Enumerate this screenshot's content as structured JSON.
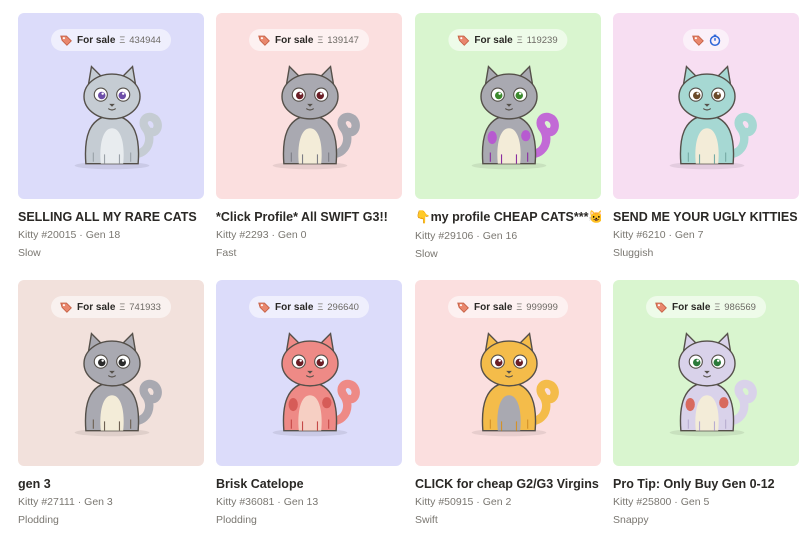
{
  "cards": [
    {
      "bg": "#dcdcfa",
      "status": "For sale",
      "eth": "Ξ",
      "price": "434944",
      "timer": false,
      "title": "SELLING ALL MY RARE CATS",
      "kitty": "Kitty #20015",
      "gen": "Gen 18",
      "speed": "Slow",
      "body": "#c5ccd3",
      "belly": "#e8ecef",
      "tail": "#c5ccd3",
      "eye": "#6d4ea8",
      "spots": "",
      "accent": "#9aa1a8"
    },
    {
      "bg": "#fbdfdf",
      "status": "For sale",
      "eth": "Ξ",
      "price": "139147",
      "timer": false,
      "title": "*Click Profile* All SWIFT G3!!",
      "kitty": "Kitty #2293",
      "gen": "Gen 0",
      "speed": "Fast",
      "body": "#a9a9b1",
      "belly": "#f3ecd8",
      "tail": "#a9a9b1",
      "eye": "#6b1f27",
      "spots": "",
      "accent": "#7d7d85"
    },
    {
      "bg": "#d9f5cf",
      "status": "For sale",
      "eth": "Ξ",
      "price": "119239",
      "timer": false,
      "title": "👇my profile CHEAP CATS***😺😺",
      "kitty": "Kitty #29106",
      "gen": "Gen 16",
      "speed": "Slow",
      "body": "#a9a9b1",
      "belly": "#f3ecd8",
      "tail": "#c26ad6",
      "eye": "#3c8a2e",
      "spots": "#b75ad0",
      "accent": "#8a2da0"
    },
    {
      "bg": "#f7def2",
      "status": "",
      "eth": "",
      "price": "",
      "timer": true,
      "title": "SEND ME YOUR UGLY KITTIES",
      "kitty": "Kitty #6210",
      "gen": "Gen 7",
      "speed": "Sluggish",
      "body": "#a6d8d3",
      "belly": "#f3ecd8",
      "tail": "#a6d8d3",
      "eye": "#6b4a2a",
      "spots": "",
      "accent": "#76aaa4"
    },
    {
      "bg": "#f2e1dc",
      "status": "For sale",
      "eth": "Ξ",
      "price": "741933",
      "timer": false,
      "title": "gen 3",
      "kitty": "Kitty #27111",
      "gen": "Gen 3",
      "speed": "Plodding",
      "body": "#a9a9b1",
      "belly": "#f3ecd8",
      "tail": "#a9a9b1",
      "eye": "#2b2b2b",
      "spots": "",
      "accent": "#6d6052"
    },
    {
      "bg": "#dcdcfa",
      "status": "For sale",
      "eth": "Ξ",
      "price": "296640",
      "timer": false,
      "title": "Brisk Catelope",
      "kitty": "Kitty #36081",
      "gen": "Gen 13",
      "speed": "Plodding",
      "body": "#ee8a86",
      "belly": "#f6cfc3",
      "tail": "#ee8a86",
      "eye": "#6b1f27",
      "spots": "#d65c58",
      "accent": "#c54a48"
    },
    {
      "bg": "#fbdfdf",
      "status": "For sale",
      "eth": "Ξ",
      "price": "999999",
      "timer": false,
      "title": "CLICK for cheap G2/G3 Virgins",
      "kitty": "Kitty #50915",
      "gen": "Gen 2",
      "speed": "Swift",
      "body": "#f4bc4a",
      "belly": "#a9a9b1",
      "tail": "#f4bc4a",
      "eye": "#6b1f27",
      "spots": "",
      "accent": "#d3922a"
    },
    {
      "bg": "#d9f5cf",
      "status": "For sale",
      "eth": "Ξ",
      "price": "986569",
      "timer": false,
      "title": "Pro Tip: Only Buy Gen 0-12",
      "kitty": "Kitty #25800",
      "gen": "Gen 5",
      "speed": "Snappy",
      "body": "#d9d2ea",
      "belly": "#f3ecd8",
      "tail": "#d9d2ea",
      "eye": "#2b7a3a",
      "spots": "#d86a5e",
      "accent": "#b8add0"
    }
  ],
  "icons": {
    "tag": "price-tag-icon",
    "timer": "clock-icon"
  }
}
